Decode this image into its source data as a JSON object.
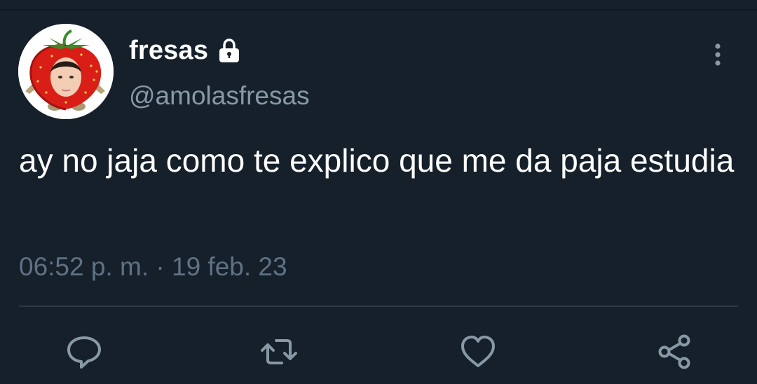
{
  "tweet": {
    "display_name": "fresas",
    "handle": "@amolasfresas",
    "text": "ay no jaja como te explico que me da paja estudia",
    "timestamp": "06:52 p. m. · 19 feb. 23",
    "protected": true
  },
  "icons": {
    "lock": "lock-icon",
    "more": "more-vertical-icon",
    "reply": "reply-icon",
    "retweet": "retweet-icon",
    "like": "heart-icon",
    "share": "share-icon"
  },
  "colors": {
    "background": "#15202b",
    "text_primary": "#ffffff",
    "text_secondary": "#8899a6",
    "icon": "#8899a6",
    "divider": "#2b3945"
  }
}
